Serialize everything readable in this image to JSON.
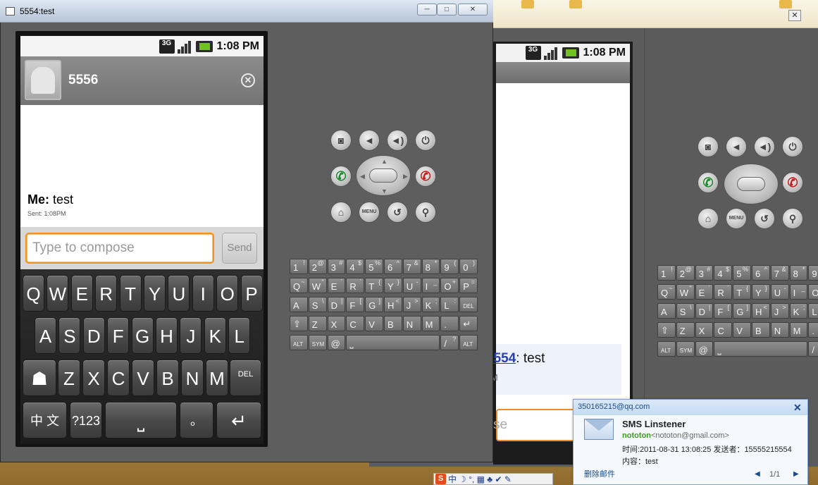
{
  "main_window": {
    "title": "5554:test",
    "minimize": "─",
    "maximize": "□",
    "close": "✕"
  },
  "status": {
    "network": "3G",
    "time": "1:08 PM"
  },
  "conversation": {
    "contact_name": "5556",
    "message_sender": "Me:",
    "message_text": "test",
    "sent_time": "Sent: 1:08PM"
  },
  "compose": {
    "placeholder": "Type to compose",
    "send_label": "Send"
  },
  "soft_keyboard": {
    "row1": [
      "Q",
      "W",
      "E",
      "R",
      "T",
      "Y",
      "U",
      "I",
      "O",
      "P"
    ],
    "row2": [
      "A",
      "S",
      "D",
      "F",
      "G",
      "H",
      "J",
      "K",
      "L"
    ],
    "row3": [
      "Z",
      "X",
      "C",
      "V",
      "B",
      "N",
      "M"
    ],
    "del_label": "DEL",
    "lang_label": "中 文",
    "sym_label": "?123",
    "dot_label": "。",
    "enter_icon": "↵",
    "settings_icon": "android-icon"
  },
  "controls": {
    "menu_label": "MENU"
  },
  "hw_keyboard": {
    "row1": [
      [
        "1",
        "!"
      ],
      [
        "2",
        "@"
      ],
      [
        "3",
        "#"
      ],
      [
        "4",
        "$"
      ],
      [
        "5",
        "%"
      ],
      [
        "6",
        "^"
      ],
      [
        "7",
        "&"
      ],
      [
        "8",
        "*"
      ],
      [
        "9",
        "("
      ],
      [
        "0",
        ")"
      ]
    ],
    "row2": [
      [
        "Q",
        "~"
      ],
      [
        "W",
        "\""
      ],
      [
        "E",
        "´"
      ],
      [
        "R",
        "`"
      ],
      [
        "T",
        "{"
      ],
      [
        "Y",
        "}"
      ],
      [
        "U",
        "-"
      ],
      [
        "I",
        "_"
      ],
      [
        "O",
        "+"
      ],
      [
        "P",
        "="
      ]
    ],
    "row3": [
      [
        "A",
        ""
      ],
      [
        "S",
        "\\"
      ],
      [
        "D",
        "|"
      ],
      [
        "F",
        "["
      ],
      [
        "G",
        "]"
      ],
      [
        "H",
        "<"
      ],
      [
        "J",
        ">"
      ],
      [
        "K",
        ";"
      ],
      [
        "L",
        ":"
      ]
    ],
    "row4": [
      [
        "Z",
        ""
      ],
      [
        "X",
        ""
      ],
      [
        "C",
        ""
      ],
      [
        "V",
        ""
      ],
      [
        "B",
        ""
      ],
      [
        "N",
        ""
      ],
      [
        "M",
        ""
      ],
      [
        ".",
        ""
      ]
    ],
    "alt": "ALT",
    "sym": "SYM",
    "at": "@",
    "space": "⎵",
    "slash": "/",
    "question": "?",
    "comma": ",",
    "del": "DEL"
  },
  "background_window": {
    "time": "1:08 PM",
    "network": "3G",
    "message_link": "5554",
    "message_text": ": test",
    "message_sub": "M",
    "compose_fragment": "se"
  },
  "notification": {
    "email": "350165215@qq.com",
    "app_name": "SMS Linstener",
    "sender_name": "nototon",
    "sender_email": "<nototon@gmail.com>",
    "meta": "时间:2011-08-31 13:08:25 发送者：15555215554",
    "content": "内容：test",
    "delete_label": "删除邮件",
    "page": "1/1",
    "prev": "◀",
    "next": "▶",
    "close": "✕"
  },
  "ime": {
    "logo": "S",
    "lang": "中",
    "icons": "☽ °, ▦ ♣ ✔ ✎"
  }
}
